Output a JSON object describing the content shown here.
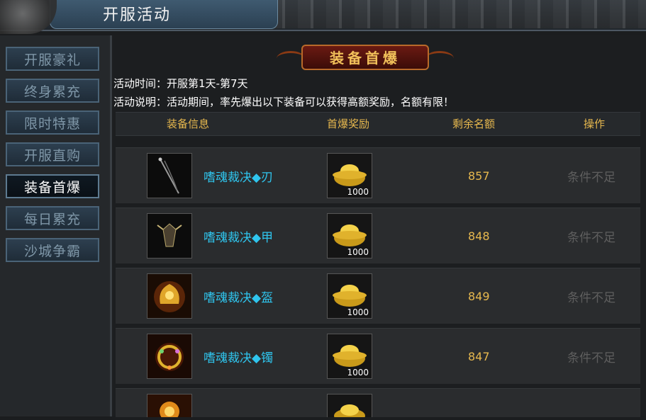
{
  "window": {
    "title": "开服活动"
  },
  "sidebar": {
    "items": [
      {
        "label": "开服豪礼",
        "active": false
      },
      {
        "label": "终身累充",
        "active": false
      },
      {
        "label": "限时特惠",
        "active": false
      },
      {
        "label": "开服直购",
        "active": false
      },
      {
        "label": "装备首爆",
        "active": true
      },
      {
        "label": "每日累充",
        "active": false
      },
      {
        "label": "沙城争霸",
        "active": false
      }
    ]
  },
  "panel": {
    "banner": "装备首爆",
    "time_line": "活动时间：开服第1天-第7天",
    "desc_line": "活动说明：活动期间，率先爆出以下装备可以获得高额奖励，名额有限！"
  },
  "table": {
    "headers": [
      "装备信息",
      "首爆奖励",
      "剩余名额",
      "操作"
    ],
    "rows": [
      {
        "name": "嗜魂裁决◆刃",
        "icon": "sword-icon",
        "reward_qty": "1000",
        "remaining": "857",
        "action": "条件不足"
      },
      {
        "name": "嗜魂裁决◆甲",
        "icon": "armor-icon",
        "reward_qty": "1000",
        "remaining": "848",
        "action": "条件不足"
      },
      {
        "name": "嗜魂裁决◆盔",
        "icon": "helmet-icon",
        "reward_qty": "1000",
        "remaining": "849",
        "action": "条件不足"
      },
      {
        "name": "嗜魂裁决◆镯",
        "icon": "bracelet-icon",
        "reward_qty": "1000",
        "remaining": "847",
        "action": "条件不足"
      }
    ]
  },
  "colors": {
    "accent_gold": "#e7b84e",
    "item_cyan": "#2fc5ee",
    "disabled_gray": "#5e5e5e"
  }
}
